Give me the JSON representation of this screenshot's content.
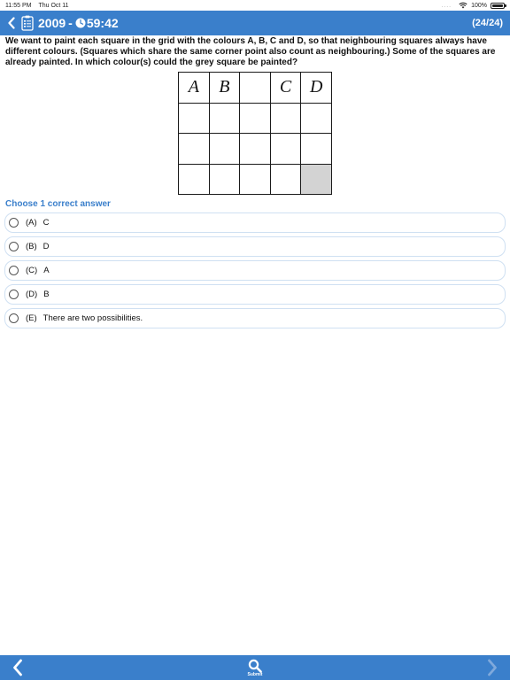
{
  "status_bar": {
    "time": "11:55 PM",
    "date": "Thu Oct 11",
    "signal_dots": "....",
    "battery": "100%",
    "battery_level": 1.0
  },
  "header": {
    "year": "2009",
    "separator": "-",
    "timer": "59:42",
    "progress": "(24/24)",
    "icons": [
      "back-chevron-icon",
      "document-list-icon",
      "clock-icon"
    ],
    "background_color": "#3a7fcb"
  },
  "question": {
    "text": "We want to paint each square in the grid with the colours  A, B, C and D, so that neighbouring squares always have different colours. (Squares which share the same corner point also count as neighbouring.) Some of the squares are already painted. In which colour(s) could the grey square be painted?"
  },
  "grid": {
    "rows": [
      [
        "A",
        "B",
        "",
        "C",
        "D"
      ],
      [
        "",
        "",
        "",
        "",
        ""
      ],
      [
        "",
        "",
        "",
        "",
        ""
      ],
      [
        "",
        "",
        "",
        "",
        ""
      ]
    ],
    "grey_cell": [
      3,
      4
    ],
    "grey_color": "#d3d3d3"
  },
  "answers": {
    "instruction": "Choose 1 correct answer",
    "options": [
      {
        "letter": "(A)",
        "text": "C"
      },
      {
        "letter": "(B)",
        "text": "D"
      },
      {
        "letter": "(C)",
        "text": "A"
      },
      {
        "letter": "(D)",
        "text": "B"
      },
      {
        "letter": "(E)",
        "text": "There are two possibilities."
      }
    ],
    "accent_color": "#3a7fcb"
  },
  "bottom_bar": {
    "submit_label": "Submit",
    "icons": [
      "previous-chevron-icon",
      "search-icon",
      "next-chevron-icon"
    ]
  }
}
